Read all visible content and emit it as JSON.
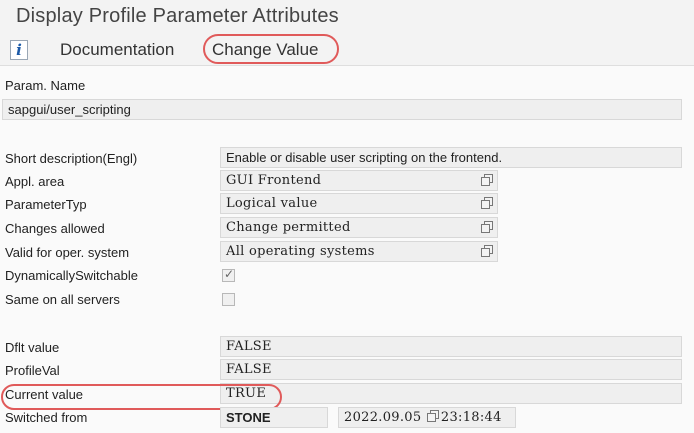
{
  "window": {
    "title": "Display Profile Parameter Attributes"
  },
  "toolbar": {
    "info_icon": "i",
    "documentation_label": "Documentation",
    "change_value_label": "Change Value"
  },
  "param": {
    "name_label": "Param. Name",
    "name_value": "sapgui/user_scripting"
  },
  "attributes": {
    "short_desc_label": "Short description(Engl)",
    "short_desc_value": "Enable or disable user scripting on the frontend.",
    "appl_area_label": "Appl. area",
    "appl_area_value": "GUI Frontend",
    "param_type_label": "ParameterTyp",
    "param_type_value": "Logical value",
    "changes_allowed_label": "Changes allowed",
    "changes_allowed_value": "Change permitted",
    "valid_os_label": "Valid for oper. system",
    "valid_os_value": "All operating systems",
    "dyn_switchable_label": "DynamicallySwitchable",
    "dyn_switchable_checked": true,
    "same_all_servers_label": "Same on all servers",
    "same_all_servers_checked": false
  },
  "values": {
    "default_label": "Dflt value",
    "default_value": "FALSE",
    "profile_label": "ProfileVal",
    "profile_value": "FALSE",
    "current_label": "Current value",
    "current_value": "TRUE",
    "switched_from_label": "Switched from",
    "switched_from_value": "STONE",
    "switched_date": "2022.09.05",
    "switched_time": "23:18:44"
  },
  "colors": {
    "highlight": "#e05a5a",
    "info_icon": "#1c5aa8"
  }
}
